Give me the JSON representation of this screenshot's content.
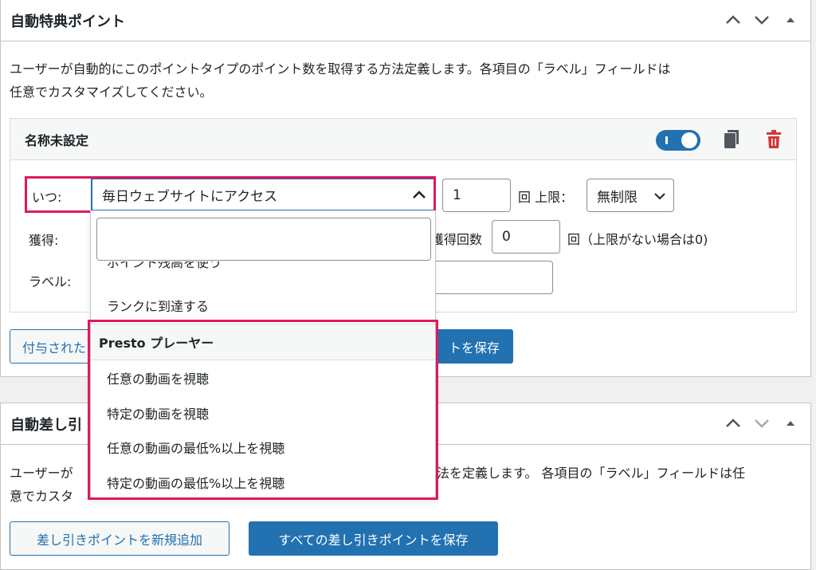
{
  "panel1": {
    "title": "自動特典ポイント",
    "description_line1": "ユーザーが自動的にこのポイントタイプのポイント数を取得する方法定義します。各項目の「ラベル」フィールドは",
    "description_line2": "任意でカスタマイズしてください。",
    "item": {
      "title": "名称未設定",
      "toggle_on": true,
      "when_label": "いつ:",
      "when_value": "毎日ウェブサイトにアクセス",
      "limit_count": "1",
      "limit_label": "回 上限：",
      "limit_select": "無制限",
      "earn_label": "獲得:",
      "earn_count_label": "獲得回数",
      "earn_count_value": "0",
      "earn_suffix": "回（上限がない場合は0)",
      "label_label": "ラベル:"
    },
    "btn_add_partial": "付与された",
    "btn_save_partial": "トを保存"
  },
  "panel2": {
    "title_partial": "自動差し引",
    "description_line1_left": "ユーザーが",
    "description_line1_right": "法を定義します。 各項目の「ラベル」フィールドは任",
    "description_line2_left": "意でカスタ",
    "btn_add": "差し引きポイントを新規追加",
    "btn_save": "すべての差し引きポイントを保存"
  },
  "dropdown": {
    "search_value": "",
    "clipped_item": "ポイント残高を使う",
    "item_rank": "ランクに到達する",
    "group_label": "Presto プレーヤー",
    "options": [
      "任意の動画を視聴",
      "特定の動画を視聴",
      "任意の動画の最低%以上を視聴",
      "特定の動画の最低%以上を視聴"
    ]
  },
  "colors": {
    "accent": "#2271b1",
    "highlight": "#e0185f",
    "delete": "#d63638"
  }
}
